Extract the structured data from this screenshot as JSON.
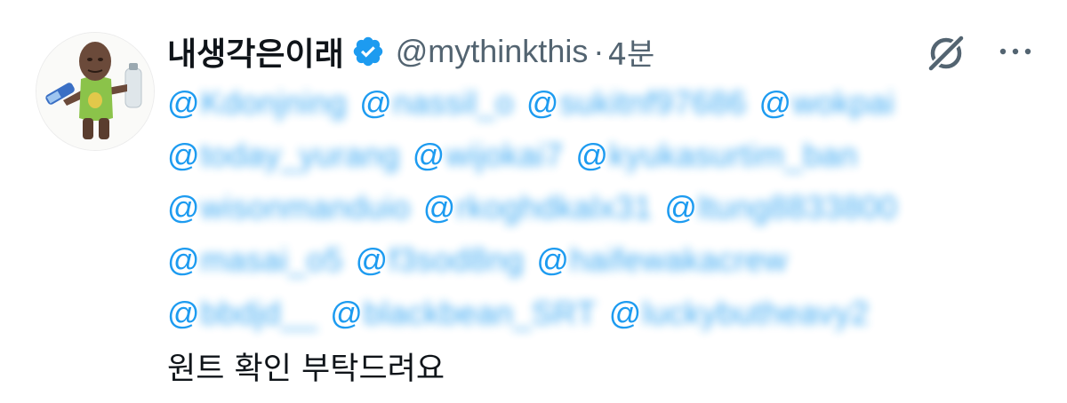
{
  "tweet": {
    "display_name": "내생각은이래",
    "handle": "@mythinkthis",
    "separator": "·",
    "timestamp": "4분",
    "verified": true,
    "body_text": "원트 확인 부탁드려요"
  },
  "mentions": {
    "at": "@",
    "lines": [
      [
        "Kdonjning",
        "nassil_o",
        "sukitnf97686",
        "wokpai"
      ],
      [
        "today_yurang",
        "wijokai7",
        "kyukasurtim_ban"
      ],
      [
        "wisonmanduio",
        "rkoghdkalx31",
        "ltung8833800"
      ],
      [
        "masai_o5",
        "f3sod8ng",
        "haifewakacrew"
      ],
      [
        "bbdjd__",
        "blackbean_SRT",
        "luckybutheavy2"
      ]
    ]
  },
  "icons": {
    "verified": "verified-badge-icon",
    "grok": "grok-icon",
    "more": "more-horizontal-icon"
  },
  "colors": {
    "mention_blue": "#1d9bf0",
    "secondary_gray": "#536471",
    "text_primary": "#0f1419",
    "verified_blue": "#1d9bf0"
  }
}
